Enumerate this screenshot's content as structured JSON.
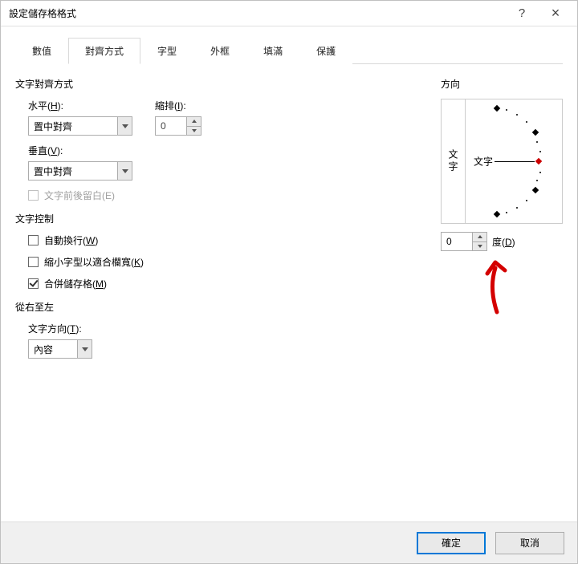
{
  "dialog": {
    "title": "設定儲存格格式"
  },
  "titlebar": {
    "help": "?",
    "close": "×"
  },
  "tabs": {
    "items": [
      {
        "label": "數值"
      },
      {
        "label": "對齊方式"
      },
      {
        "label": "字型"
      },
      {
        "label": "外框"
      },
      {
        "label": "填滿"
      },
      {
        "label": "保護"
      }
    ],
    "active_index": 1
  },
  "alignment": {
    "section_label": "文字對齊方式",
    "horizontal": {
      "label": "水平(H):",
      "value": "置中對齊"
    },
    "indent": {
      "label": "縮排(I):",
      "value": "0"
    },
    "vertical": {
      "label": "垂直(V):",
      "value": "置中對齊"
    },
    "justify_distributed": {
      "label": "文字前後留白(E)",
      "checked": false,
      "enabled": false
    }
  },
  "text_control": {
    "section_label": "文字控制",
    "wrap": {
      "label": "自動換行(W)",
      "checked": false
    },
    "shrink": {
      "label": "縮小字型以適合欄寬(K)",
      "checked": false
    },
    "merge": {
      "label": "合併儲存格(M)",
      "checked": true
    }
  },
  "rtl": {
    "section_label": "從右至左",
    "direction": {
      "label": "文字方向(T):",
      "value": "內容"
    }
  },
  "orientation": {
    "section_label": "方向",
    "vertical_text": "文字",
    "dial_label": "文字",
    "degrees_value": "0",
    "degrees_label": "度(D)"
  },
  "footer": {
    "ok": "確定",
    "cancel": "取消"
  }
}
